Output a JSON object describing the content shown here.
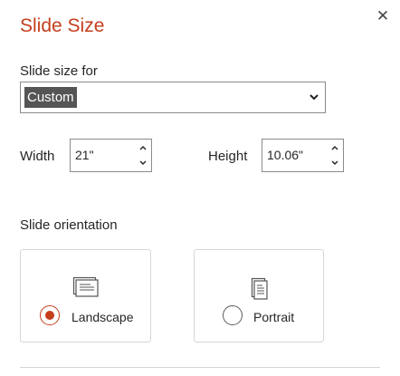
{
  "dialog": {
    "title": "Slide Size",
    "close_glyph": "✕"
  },
  "slide_size_for": {
    "label": "Slide size for",
    "selected": "Custom"
  },
  "width": {
    "label": "Width",
    "value": "21\""
  },
  "height": {
    "label": "Height",
    "value": "10.06\""
  },
  "orientation": {
    "label": "Slide orientation",
    "options": [
      {
        "label": "Landscape",
        "icon": "landscape-slide-icon",
        "selected": true
      },
      {
        "label": "Portrait",
        "icon": "portrait-slide-icon",
        "selected": false
      }
    ]
  },
  "colors": {
    "accent": "#c43e1c",
    "border": "#8a8a8a"
  }
}
